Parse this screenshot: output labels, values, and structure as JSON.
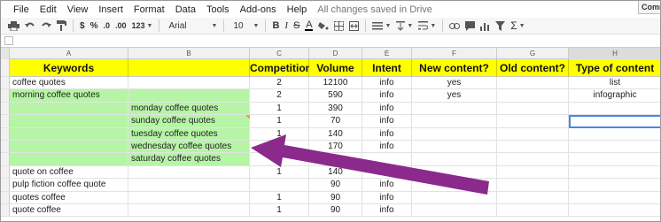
{
  "menu": {
    "items": [
      "File",
      "Edit",
      "View",
      "Insert",
      "Format",
      "Data",
      "Tools",
      "Add-ons",
      "Help"
    ],
    "status": "All changes saved in Drive",
    "comments_label": "Comme"
  },
  "toolbar": {
    "currency": "$",
    "percent": "%",
    "decimal_less": ".0",
    "decimal_more": ".00",
    "number_format": "123",
    "font_name": "Arial",
    "font_size": "10",
    "bold": "B",
    "italic": "I",
    "strike": "S",
    "text_color": "A",
    "sum": "Σ",
    "icons": [
      "print-icon",
      "undo-icon",
      "redo-icon",
      "paint-format-icon",
      "text-color-icon",
      "fill-color-icon",
      "borders-icon",
      "merge-icon",
      "align-icon",
      "valign-icon",
      "wrap-icon",
      "link-icon",
      "comment-icon",
      "chart-icon",
      "filter-icon",
      "sum-icon"
    ]
  },
  "columns": [
    "A",
    "B",
    "C",
    "D",
    "E",
    "F",
    "G",
    "H"
  ],
  "selected_column": "H",
  "header_row": [
    "Keywords",
    "",
    "Competition",
    "Volume",
    "Intent",
    "New content?",
    "Old content?",
    "Type of content"
  ],
  "rows": [
    {
      "A": "coffee quotes",
      "B": "",
      "C": "2",
      "D": "12100",
      "E": "info",
      "F": "yes",
      "G": "",
      "H": "list"
    },
    {
      "A": "morning coffee quotes",
      "B": "",
      "C": "2",
      "D": "590",
      "E": "info",
      "F": "yes",
      "G": "",
      "H": "infographic"
    },
    {
      "A": "",
      "B": "monday coffee quotes",
      "C": "1",
      "D": "390",
      "E": "info",
      "F": "",
      "G": "",
      "H": ""
    },
    {
      "A": "",
      "B": "sunday coffee quotes",
      "C": "1",
      "D": "70",
      "E": "info",
      "F": "",
      "G": "",
      "H": ""
    },
    {
      "A": "",
      "B": "tuesday coffee quotes",
      "C": "1",
      "D": "140",
      "E": "info",
      "F": "",
      "G": "",
      "H": ""
    },
    {
      "A": "",
      "B": "wednesday coffee quotes",
      "C": "",
      "D": "170",
      "E": "info",
      "F": "",
      "G": "",
      "H": ""
    },
    {
      "A": "",
      "B": "saturday coffee quotes",
      "C": "",
      "D": "",
      "E": "",
      "F": "",
      "G": "",
      "H": ""
    },
    {
      "A": "quote on coffee",
      "B": "",
      "C": "1",
      "D": "140",
      "E": "",
      "F": "",
      "G": "",
      "H": ""
    },
    {
      "A": "pulp fiction coffee quote",
      "B": "",
      "C": "",
      "D": "90",
      "E": "info",
      "F": "",
      "G": "",
      "H": ""
    },
    {
      "A": "quotes coffee",
      "B": "",
      "C": "1",
      "D": "90",
      "E": "info",
      "F": "",
      "G": "",
      "H": ""
    },
    {
      "A": "quote coffee",
      "B": "",
      "C": "1",
      "D": "90",
      "E": "info",
      "F": "",
      "G": "",
      "H": ""
    }
  ],
  "colors": {
    "header_fill": "#ffff00",
    "highlight_fill": "#b6f5a6",
    "arrow": "#8b2a8c",
    "selection": "#4a86e8"
  }
}
